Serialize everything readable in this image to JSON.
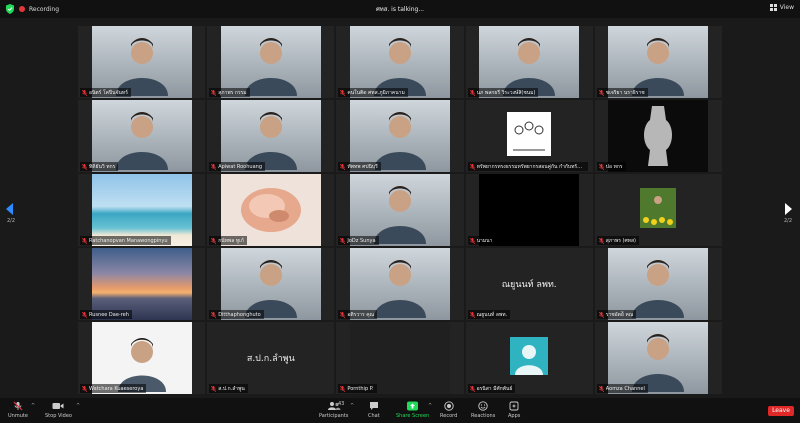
{
  "topbar": {
    "recording_label": "Recording",
    "talking_label": "ศทส. is talking...",
    "view_label": "View"
  },
  "pagination": {
    "left": "2/2",
    "right": "2/2"
  },
  "participants": [
    {
      "name": "อนิตร์ โคปิ่นจันทร์",
      "scene": "person",
      "muted": true
    },
    {
      "name": "สุภาพร กรรม",
      "scene": "person",
      "muted": true
    },
    {
      "name": "คนในติด ศทส.ภูมิภาคนาม",
      "scene": "person",
      "muted": true
    },
    {
      "name": "นภ พลกธรี  วิระวงษ์สิ(ชนม)",
      "scene": "person",
      "muted": true
    },
    {
      "name": "ชเจริยา นราธิราช",
      "scene": "person",
      "muted": true
    },
    {
      "name": "ทิดิยันวิ ทกร",
      "scene": "person",
      "muted": true
    },
    {
      "name": "Apiwat Roohuang",
      "scene": "person",
      "muted": true
    },
    {
      "name": "ทัพทพ ศปนิบุรี",
      "scene": "person",
      "muted": true
    },
    {
      "name": "ทรัพยากรทรงธรรมทรัพยากรสอนคู่กัน กำกับทรัพยากรทรงรฐ",
      "scene": "illustration",
      "muted": true
    },
    {
      "name": "ปอ ทกร",
      "scene": "vase",
      "muted": true
    },
    {
      "name": "Ratchanopvan Manawongpinyu",
      "scene": "beach",
      "muted": true
    },
    {
      "name": "กนัทพล ทูเก้",
      "scene": "shell",
      "muted": true
    },
    {
      "name": "JoDz Sunya",
      "scene": "person",
      "muted": true
    },
    {
      "name": "นามนา",
      "scene": "black",
      "muted": true
    },
    {
      "name": "สุภาพร (ศทส)",
      "scene": "flowers",
      "muted": true
    },
    {
      "name": "Rusnee Dae-reh",
      "scene": "sunset",
      "muted": true
    },
    {
      "name": "Ditthaphonghuto",
      "scene": "person",
      "muted": true
    },
    {
      "name": "อติรวาร คุณ",
      "scene": "person",
      "muted": true
    },
    {
      "name": "ณยูนนท์ ลพท.",
      "scene": "text",
      "display_text": "ณยูนนท์ ลพท.",
      "muted": true
    },
    {
      "name": "ราชอัตย์ี คณ",
      "scene": "person",
      "muted": true
    },
    {
      "name": "Watchara Kuaeseroya",
      "scene": "person-white",
      "muted": true
    },
    {
      "name": "ส.ป.ก.ลำพูน",
      "scene": "text",
      "display_text": "ส.ป.ก.ลำพูน",
      "muted": true
    },
    {
      "name": "Pornthip P.",
      "scene": "dark",
      "muted": true
    },
    {
      "name": "อรนิสา มีศักพันธ์",
      "scene": "avatar",
      "muted": true
    },
    {
      "name": "Aomza Channel",
      "scene": "person",
      "muted": true
    }
  ],
  "toolbar": {
    "unmute": "Unmute",
    "stop_video": "Stop Video",
    "participants": "Participants",
    "participants_count": "43",
    "chat": "Chat",
    "share_screen": "Share Screen",
    "record": "Record",
    "reactions": "Reactions",
    "apps": "Apps",
    "leave": "Leave"
  },
  "colors": {
    "accent": "#2d8cff",
    "share_green": "#23d959",
    "leave_red": "#e02828",
    "muted_red": "#e5363a",
    "tile_bg": "#232323"
  }
}
